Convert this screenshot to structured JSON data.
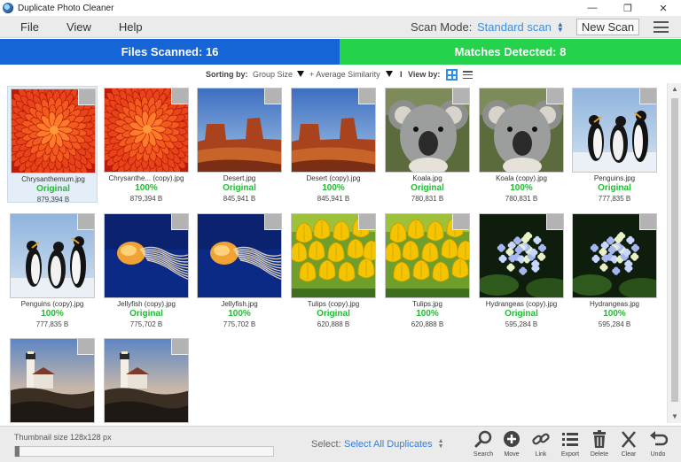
{
  "window": {
    "title": "Duplicate Photo Cleaner",
    "controls": [
      "—",
      "❐",
      "✕"
    ]
  },
  "menu": {
    "items": [
      "File",
      "View",
      "Help"
    ],
    "scan_mode_label": "Scan Mode:",
    "scan_mode_value": "Standard scan",
    "new_scan_label": "New Scan"
  },
  "status": {
    "files_scanned": "Files Scanned: 16",
    "matches_detected": "Matches Detected: 8",
    "colors": {
      "files": "#1565d6",
      "matches": "#24d24c"
    }
  },
  "sorting": {
    "label": "Sorting by:",
    "primary": "Group Size",
    "secondary": "+ Average Similarity",
    "separator": "I",
    "view_by_label": "View by:"
  },
  "photos": [
    {
      "name": "Chrysanthemum.jpg",
      "match": "Original",
      "size": "879,394 B",
      "selected": true,
      "art": "flower"
    },
    {
      "name": "Chrysanthe... (copy).jpg",
      "match": "100%",
      "size": "879,394 B",
      "art": "flower"
    },
    {
      "name": "Desert.jpg",
      "match": "Original",
      "size": "845,941 B",
      "art": "desert"
    },
    {
      "name": "Desert (copy).jpg",
      "match": "100%",
      "size": "845,941 B",
      "art": "desert"
    },
    {
      "name": "Koala.jpg",
      "match": "Original",
      "size": "780,831 B",
      "art": "koala"
    },
    {
      "name": "Koala (copy).jpg",
      "match": "100%",
      "size": "780,831 B",
      "art": "koala"
    },
    {
      "name": "Penguins.jpg",
      "match": "Original",
      "size": "777,835 B",
      "art": "penguins"
    },
    {
      "name": "Penguins (copy).jpg",
      "match": "100%",
      "size": "777,835 B",
      "art": "penguins"
    },
    {
      "name": "Jellyfish (copy).jpg",
      "match": "Original",
      "size": "775,702 B",
      "art": "jellyfish"
    },
    {
      "name": "Jellyfish.jpg",
      "match": "100%",
      "size": "775,702 B",
      "art": "jellyfish"
    },
    {
      "name": "Tulips (copy).jpg",
      "match": "Original",
      "size": "620,888 B",
      "art": "tulips"
    },
    {
      "name": "Tulips.jpg",
      "match": "100%",
      "size": "620,888 B",
      "art": "tulips"
    },
    {
      "name": "Hydrangeas (copy).jpg",
      "match": "Original",
      "size": "595,284 B",
      "art": "hydrangea"
    },
    {
      "name": "Hydrangeas.jpg",
      "match": "100%",
      "size": "595,284 B",
      "art": "hydrangea"
    },
    {
      "name": "",
      "match": "",
      "size": "",
      "art": "lighthouse"
    },
    {
      "name": "",
      "match": "",
      "size": "",
      "art": "lighthouse"
    }
  ],
  "bottom": {
    "thumb_size_label": "Thumbnail size 128x128 px",
    "select_label": "Select:",
    "select_value": "Select All Duplicates",
    "tools": [
      {
        "label": "Search",
        "icon": "search-icon"
      },
      {
        "label": "Move",
        "icon": "move-icon"
      },
      {
        "label": "Link",
        "icon": "link-icon"
      },
      {
        "label": "Export",
        "icon": "export-icon"
      },
      {
        "label": "Delete",
        "icon": "trash-icon"
      },
      {
        "label": "Clear",
        "icon": "clear-icon"
      },
      {
        "label": "Undo",
        "icon": "undo-icon"
      }
    ]
  }
}
